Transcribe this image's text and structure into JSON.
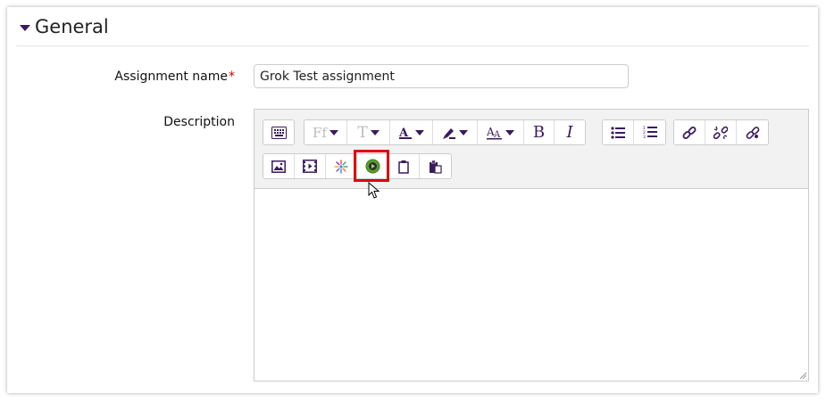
{
  "section": {
    "title": "General"
  },
  "form": {
    "assignment_name_label": "Assignment name",
    "required_mark": "*",
    "assignment_name_value": "Grok Test assignment",
    "description_label": "Description"
  },
  "toolbar": {
    "row1": [
      {
        "name": "show-more-buttons",
        "icon": "keyboard-icon"
      },
      {
        "name": "font-family",
        "text": "Ff",
        "icon": "font-family-icon",
        "disabled": true
      },
      {
        "name": "font-size",
        "text": "T",
        "icon": "font-size-icon",
        "disabled": true
      },
      {
        "name": "font-color",
        "icon": "font-color-icon"
      },
      {
        "name": "background-color",
        "icon": "highlighter-icon"
      },
      {
        "name": "styles",
        "icon": "styles-icon"
      },
      {
        "name": "bold",
        "text": "B",
        "icon": "bold-icon"
      },
      {
        "name": "italic",
        "text": "I",
        "icon": "italic-icon"
      },
      {
        "name": "unordered-list",
        "icon": "bullet-list-icon"
      },
      {
        "name": "ordered-list",
        "icon": "numbered-list-icon"
      },
      {
        "name": "link",
        "icon": "link-icon"
      },
      {
        "name": "unlink",
        "icon": "unlink-icon"
      },
      {
        "name": "auto-link",
        "icon": "auto-link-icon"
      }
    ],
    "row2": [
      {
        "name": "image",
        "icon": "image-icon"
      },
      {
        "name": "media",
        "icon": "film-icon"
      },
      {
        "name": "h5p",
        "icon": "burst-icon"
      },
      {
        "name": "kaltura-media",
        "icon": "play-circle-icon",
        "highlighted": true
      },
      {
        "name": "copy",
        "icon": "clipboard-icon"
      },
      {
        "name": "paste",
        "icon": "paste-icon"
      }
    ]
  },
  "colors": {
    "accent": "#3a1a5e",
    "highlight_box": "#e00000",
    "required": "#cc0000",
    "play_green": "#5aa02c"
  }
}
